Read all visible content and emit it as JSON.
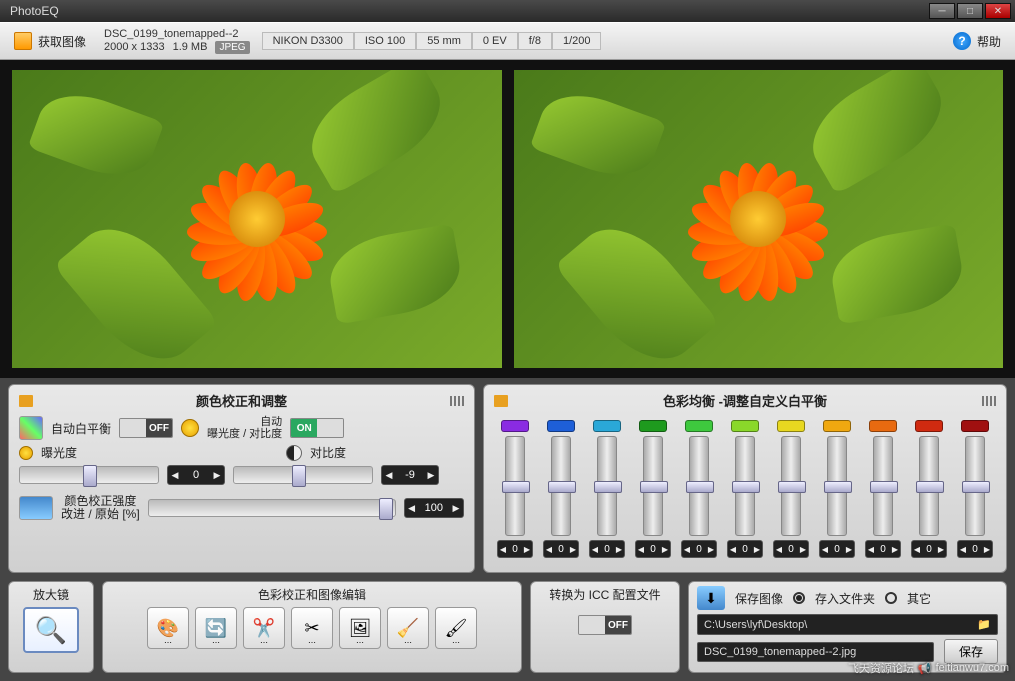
{
  "app": {
    "title": "PhotoEQ"
  },
  "toolbar": {
    "acquire_label": "获取图像",
    "help_label": "帮助",
    "file": {
      "name": "DSC_0199_tonemapped--2",
      "dimensions": "2000 x 1333",
      "size": "1.9 MB",
      "format": "JPEG"
    },
    "meta": {
      "camera": "NIKON D3300",
      "iso": "ISO 100",
      "focal": "55 mm",
      "ev": "0 EV",
      "aperture": "f/8",
      "shutter": "1/200"
    }
  },
  "panel_left": {
    "title": "颜色校正和调整",
    "auto_wb_label": "自动白平衡",
    "auto_wb_state": "OFF",
    "auto_label": "自动",
    "exposure_contrast_label": "曝光度 / 对比度",
    "exposure_contrast_state": "ON",
    "exposure_label": "曝光度",
    "exposure_value": "0",
    "contrast_label": "对比度",
    "contrast_value": "-9",
    "intensity_label1": "颜色校正强度",
    "intensity_label2": "改进 / 原始 [%]",
    "intensity_value": "100"
  },
  "panel_right": {
    "title": "色彩均衡 -调整自定义白平衡",
    "sliders": [
      {
        "color": "#8a2be2",
        "value": "0"
      },
      {
        "color": "#1e5fd8",
        "value": "0"
      },
      {
        "color": "#2aa8d8",
        "value": "0"
      },
      {
        "color": "#1e9a1e",
        "value": "0"
      },
      {
        "color": "#3ec83e",
        "value": "0"
      },
      {
        "color": "#8ad82a",
        "value": "0"
      },
      {
        "color": "#e8d820",
        "value": "0"
      },
      {
        "color": "#f0a810",
        "value": "0"
      },
      {
        "color": "#e86a10",
        "value": "0"
      },
      {
        "color": "#d02a10",
        "value": "0"
      },
      {
        "color": "#a01010",
        "value": "0"
      }
    ]
  },
  "bottom": {
    "magnifier_label": "放大镜",
    "tools_label": "色彩校正和图像编辑",
    "icc_label": "转换为 ICC 配置文件",
    "icc_state": "OFF",
    "save_label": "保存图像",
    "radio_folder": "存入文件夹",
    "radio_other": "其它",
    "path": "C:\\Users\\lyf\\Desktop\\",
    "filename": "DSC_0199_tonemapped--2.jpg",
    "save_btn": "保存"
  },
  "watermark": {
    "text": "飞天资源论坛",
    "url": "feitianwu7.com"
  }
}
